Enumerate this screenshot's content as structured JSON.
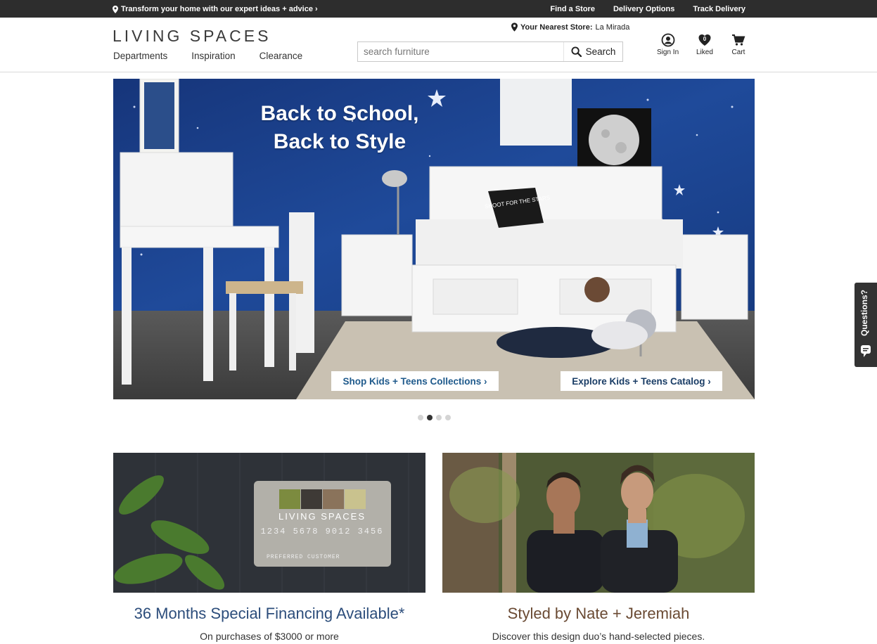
{
  "topbar": {
    "promo": "Transform your home with our expert ideas + advice ›",
    "links": [
      "Find a Store",
      "Delivery Options",
      "Track Delivery"
    ]
  },
  "header": {
    "logo": "LIVING SPACES",
    "nav": [
      "Departments",
      "Inspiration",
      "Clearance"
    ],
    "store_label": "Your Nearest Store:",
    "store_name": "La Mirada",
    "search_placeholder": "search furniture",
    "search_button": "Search",
    "account": {
      "sign_in": "Sign In",
      "liked": "Liked",
      "liked_count": "0",
      "cart": "Cart"
    }
  },
  "hero": {
    "headline_line1": "Back to School,",
    "headline_line2": "Back to Style",
    "pillow_text": "SHOOT FOR THE STARS",
    "cta_left": "Shop Kids + Teens Collections ›",
    "cta_right": "Explore Kids + Teens Catalog ›",
    "slides": 4,
    "active_slide": 2
  },
  "questions_tab": "Questions?",
  "promos": [
    {
      "title": "36 Months Special Financing Available*",
      "subtitle": "On purchases of $3000 or more",
      "card_brand": "LIVING SPACES",
      "card_number": "1234 5678 9012 3456",
      "card_label": "PREFERRED CUSTOMER"
    },
    {
      "title": "Styled by Nate + Jeremiah",
      "subtitle": "Discover this design duo’s hand-selected pieces."
    }
  ],
  "colors": {
    "topbar": "#2d2d2d",
    "hero_wall": "#1d3f85",
    "cta_text": "#1f5a8c",
    "promo_title_left": "#2c4d7b",
    "promo_title_right": "#6a4a33"
  }
}
